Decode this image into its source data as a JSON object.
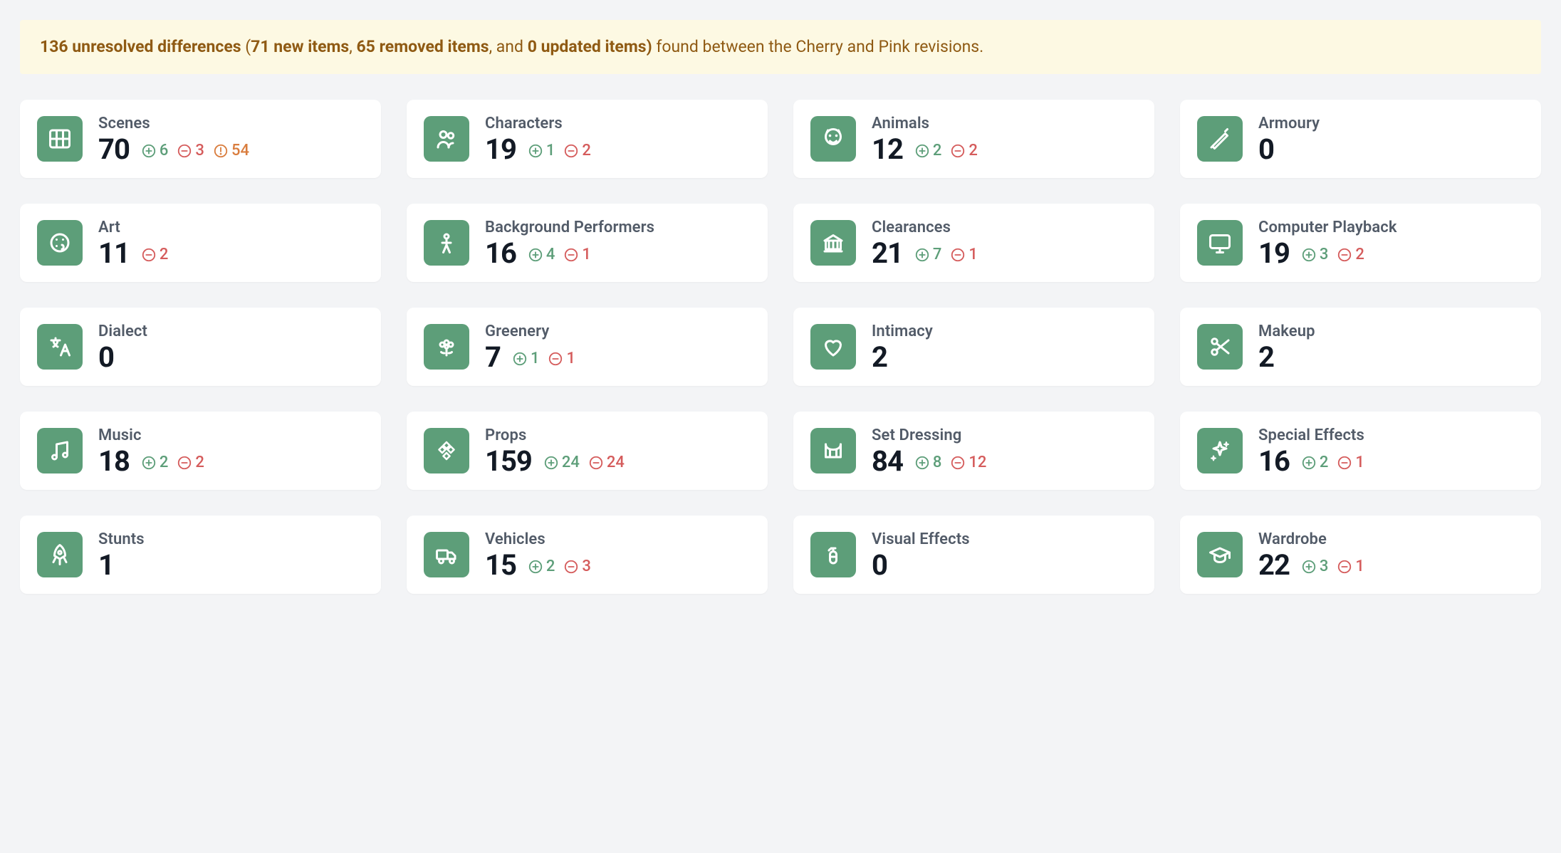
{
  "banner": {
    "unresolved": "136 unresolved differences",
    "new": "71 new items",
    "removed": "65 removed items",
    "sep_and": "and",
    "updated": "0 updated items",
    "suffix": "found between the Cherry and Pink revisions."
  },
  "cards": [
    {
      "key": "scenes",
      "label": "Scenes",
      "count": 70,
      "add": 6,
      "remove": 3,
      "warn": 54,
      "icon": "film"
    },
    {
      "key": "characters",
      "label": "Characters",
      "count": 19,
      "add": 1,
      "remove": 2,
      "warn": null,
      "icon": "users"
    },
    {
      "key": "animals",
      "label": "Animals",
      "count": 12,
      "add": 2,
      "remove": 2,
      "warn": null,
      "icon": "paw"
    },
    {
      "key": "armoury",
      "label": "Armoury",
      "count": 0,
      "add": null,
      "remove": null,
      "warn": null,
      "icon": "sword"
    },
    {
      "key": "art",
      "label": "Art",
      "count": 11,
      "add": null,
      "remove": 2,
      "warn": null,
      "icon": "palette"
    },
    {
      "key": "bg-perf",
      "label": "Background Performers",
      "count": 16,
      "add": 4,
      "remove": 1,
      "warn": null,
      "icon": "person"
    },
    {
      "key": "clearances",
      "label": "Clearances",
      "count": 21,
      "add": 7,
      "remove": 1,
      "warn": null,
      "icon": "bank"
    },
    {
      "key": "computer",
      "label": "Computer Playback",
      "count": 19,
      "add": 3,
      "remove": 2,
      "warn": null,
      "icon": "monitor"
    },
    {
      "key": "dialect",
      "label": "Dialect",
      "count": 0,
      "add": null,
      "remove": null,
      "warn": null,
      "icon": "translate"
    },
    {
      "key": "greenery",
      "label": "Greenery",
      "count": 7,
      "add": 1,
      "remove": 1,
      "warn": null,
      "icon": "flower"
    },
    {
      "key": "intimacy",
      "label": "Intimacy",
      "count": 2,
      "add": null,
      "remove": null,
      "warn": null,
      "icon": "heart"
    },
    {
      "key": "makeup",
      "label": "Makeup",
      "count": 2,
      "add": null,
      "remove": null,
      "warn": null,
      "icon": "scissors"
    },
    {
      "key": "music",
      "label": "Music",
      "count": 18,
      "add": 2,
      "remove": 2,
      "warn": null,
      "icon": "music"
    },
    {
      "key": "props",
      "label": "Props",
      "count": 159,
      "add": 24,
      "remove": 24,
      "warn": null,
      "icon": "diamond"
    },
    {
      "key": "set-dress",
      "label": "Set Dressing",
      "count": 84,
      "add": 8,
      "remove": 12,
      "warn": null,
      "icon": "stage"
    },
    {
      "key": "sfx",
      "label": "Special Effects",
      "count": 16,
      "add": 2,
      "remove": 1,
      "warn": null,
      "icon": "sparkle"
    },
    {
      "key": "stunts",
      "label": "Stunts",
      "count": 1,
      "add": null,
      "remove": null,
      "warn": null,
      "icon": "rocket"
    },
    {
      "key": "vehicles",
      "label": "Vehicles",
      "count": 15,
      "add": 2,
      "remove": 3,
      "warn": null,
      "icon": "truck"
    },
    {
      "key": "vfx",
      "label": "Visual Effects",
      "count": 0,
      "add": null,
      "remove": null,
      "warn": null,
      "icon": "extinguisher"
    },
    {
      "key": "wardrobe",
      "label": "Wardrobe",
      "count": 22,
      "add": 3,
      "remove": 1,
      "warn": null,
      "icon": "grad"
    }
  ]
}
